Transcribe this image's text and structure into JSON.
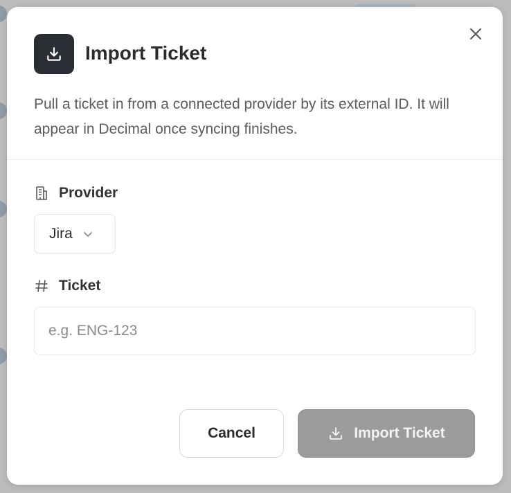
{
  "dialog": {
    "title": "Import Ticket",
    "description": "Pull a ticket in from a connected provider by its external ID. It will appear in Decimal once syncing finishes.",
    "icons": {
      "header": "download-icon",
      "close": "close-icon"
    }
  },
  "provider": {
    "label": "Provider",
    "icon": "building-icon",
    "selected": "Jira"
  },
  "ticket": {
    "label": "Ticket",
    "icon": "hash-icon",
    "value": "",
    "placeholder": "e.g. ENG-123"
  },
  "actions": {
    "cancel_label": "Cancel",
    "submit_label": "Import Ticket"
  },
  "colors": {
    "header_icon_bg": "#2a2d33",
    "primary_disabled": "#9b9b9b"
  }
}
